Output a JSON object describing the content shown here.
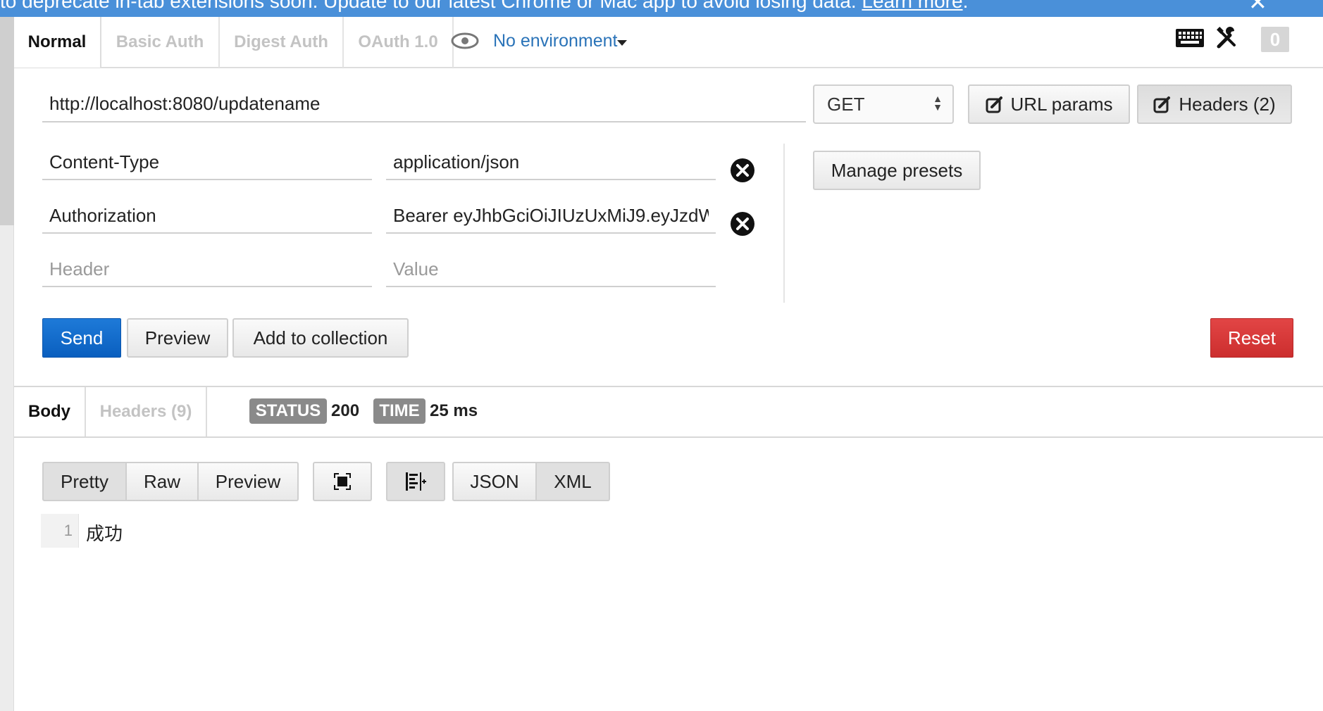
{
  "banner": {
    "text": "to deprecate in-tab extensions soon. Update to our latest Chrome or Mac app to avoid losing data.",
    "link": "Learn more",
    "close": "✕"
  },
  "auth_tabs": [
    "Normal",
    "Basic Auth",
    "Digest Auth",
    "OAuth 1.0"
  ],
  "environment": {
    "label": "No environment"
  },
  "toolbar": {
    "count": "0"
  },
  "request": {
    "url": "http://localhost:8080/updatename",
    "method": "GET",
    "url_params_label": "URL params",
    "headers_label": "Headers (2)",
    "manage_presets_label": "Manage presets"
  },
  "headers": [
    {
      "key": "Content-Type",
      "value": "application/json"
    },
    {
      "key": "Authorization",
      "value": "Bearer eyJhbGciOiJIUzUxMiJ9.eyJzdW"
    }
  ],
  "header_placeholders": {
    "key": "Header",
    "value": "Value"
  },
  "actions": {
    "send": "Send",
    "preview": "Preview",
    "add_to_collection": "Add to collection",
    "reset": "Reset"
  },
  "response": {
    "tabs": [
      "Body",
      "Headers (9)"
    ],
    "status_tag": "STATUS",
    "status_value": "200",
    "time_tag": "TIME",
    "time_value": "25 ms",
    "format_options": [
      "Pretty",
      "Raw",
      "Preview"
    ],
    "type_options": [
      "JSON",
      "XML"
    ],
    "line_number": "1",
    "body_text": "成功"
  },
  "colors": {
    "banner": "#4a90d9",
    "send": "#0a5fbf",
    "reset": "#cc2e2e",
    "link": "#2a73b8"
  }
}
